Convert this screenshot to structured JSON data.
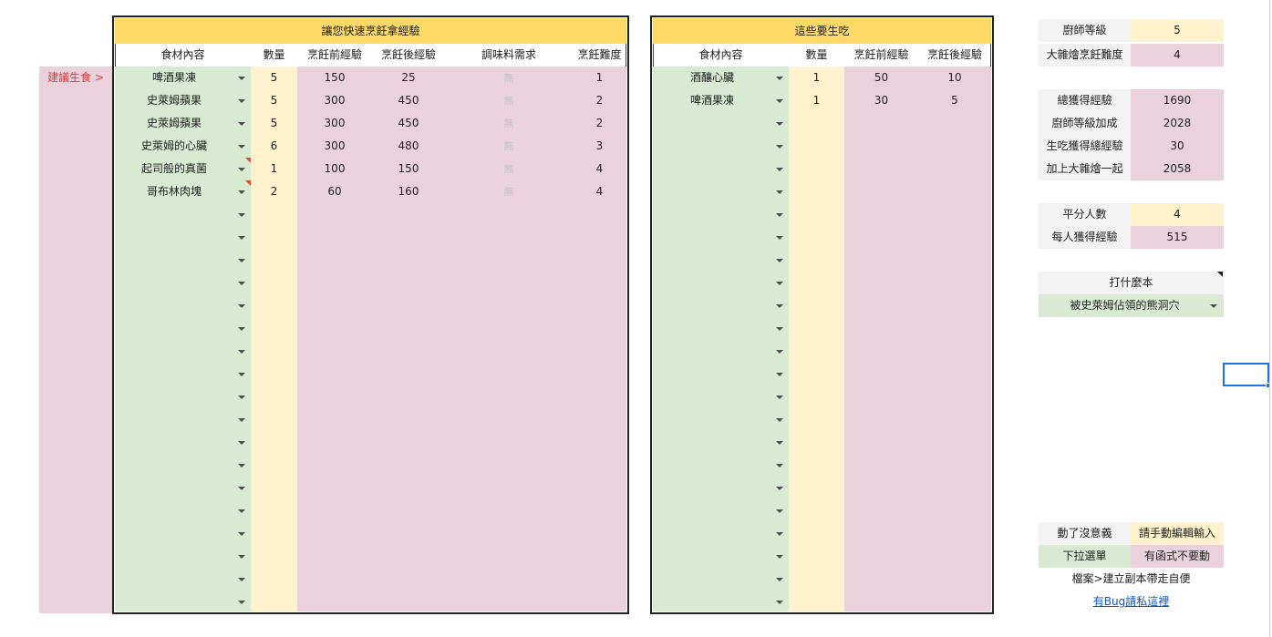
{
  "suggest_label": "建議生食 >",
  "cook_table": {
    "title": "讓您快速烹飪拿經驗",
    "headers": [
      "食材內容",
      "數量",
      "烹飪前經驗",
      "烹飪後經驗",
      "調味料需求",
      "烹飪難度"
    ],
    "rows": [
      {
        "item": "啤酒果凍",
        "qty": "5",
        "before": "150",
        "after": "25",
        "seasoning": "無",
        "difficulty": "1"
      },
      {
        "item": "史萊姆蘋果",
        "qty": "5",
        "before": "300",
        "after": "450",
        "seasoning": "無",
        "difficulty": "2"
      },
      {
        "item": "史萊姆蘋果",
        "qty": "5",
        "before": "300",
        "after": "450",
        "seasoning": "無",
        "difficulty": "2"
      },
      {
        "item": "史萊姆的心臟",
        "qty": "6",
        "before": "300",
        "after": "480",
        "seasoning": "無",
        "difficulty": "3"
      },
      {
        "item": "起司般的真菌",
        "qty": "1",
        "before": "100",
        "after": "150",
        "seasoning": "無",
        "difficulty": "4"
      },
      {
        "item": "哥布林肉塊",
        "qty": "2",
        "before": "60",
        "after": "160",
        "seasoning": "無",
        "difficulty": "4"
      }
    ]
  },
  "raw_table": {
    "title": "這些要生吃",
    "headers": [
      "食材內容",
      "數量",
      "烹飪前經驗",
      "烹飪後經驗"
    ],
    "rows": [
      {
        "item": "酒釀心臟",
        "qty": "1",
        "before": "50",
        "after": "10"
      },
      {
        "item": "啤酒果凍",
        "qty": "1",
        "before": "30",
        "after": "5"
      }
    ]
  },
  "side": {
    "chef_level_label": "廚師等級",
    "chef_level": "5",
    "stew_label": "大雜燴烹飪難度",
    "stew": "4",
    "total_label": "總獲得經驗",
    "total": "1690",
    "bonus_label": "廚師等級加成",
    "bonus": "2028",
    "raw_total_label": "生吃獲得總經驗",
    "raw_total": "30",
    "with_stew_label": "加上大雜燴一起",
    "with_stew": "2058",
    "split_label": "平分人數",
    "split": "4",
    "per_person_label": "每人獲得經驗",
    "per_person": "515",
    "dungeon_label": "打什麼本",
    "dungeon": "被史萊姆佔領的熊洞穴",
    "legend_manual_label": "動了沒意義",
    "legend_manual": "請手動編輯輸入",
    "legend_dropdown_label": "下拉選單",
    "legend_dropdown": "有函式不要動",
    "copy_note": "檔案>建立副本帶走自便",
    "bug_link": "有Bug請私這裡"
  },
  "colors": {
    "green": "#d9ead3",
    "yellow": "#fff2cc",
    "pink": "#ead1dc",
    "gold": "#ffd966",
    "accent_red": "#e0522f",
    "selection": "#1a73e8"
  }
}
